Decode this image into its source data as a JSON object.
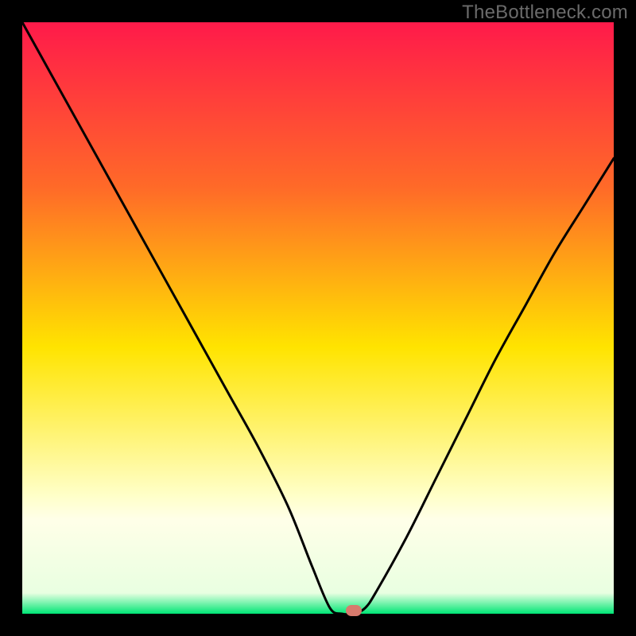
{
  "watermark": "TheBottleneck.com",
  "colors": {
    "frame": "#000000",
    "watermark": "#6b6b6b",
    "curve": "#000000",
    "marker": "#d77a6d",
    "grad_top": "#ff1a4a",
    "grad_mid_upper": "#ff8a20",
    "grad_mid": "#ffe400",
    "grad_pale": "#ffffc8",
    "grad_green": "#00e676"
  },
  "chart_data": {
    "type": "line",
    "title": "",
    "xlabel": "",
    "ylabel": "",
    "xlim": [
      0,
      100
    ],
    "ylim": [
      0,
      100
    ],
    "series": [
      {
        "name": "bottleneck-curve",
        "x": [
          0,
          5,
          10,
          15,
          20,
          25,
          30,
          35,
          40,
          45,
          49,
          52,
          54,
          56,
          58,
          60,
          65,
          70,
          75,
          80,
          85,
          90,
          95,
          100
        ],
        "y": [
          100,
          91,
          82,
          73,
          64,
          55,
          46,
          37,
          28,
          18,
          8,
          1,
          0,
          0,
          1,
          4,
          13,
          23,
          33,
          43,
          52,
          61,
          69,
          77
        ]
      }
    ],
    "marker": {
      "x": 56,
      "y": 0.5
    },
    "gradient_stops": [
      {
        "offset": 0.0,
        "color": "#ff1a4a"
      },
      {
        "offset": 0.28,
        "color": "#ff6a28"
      },
      {
        "offset": 0.55,
        "color": "#ffe400"
      },
      {
        "offset": 0.8,
        "color": "#ffffc8"
      },
      {
        "offset": 0.84,
        "color": "#ffffe8"
      },
      {
        "offset": 0.965,
        "color": "#e9ffe1"
      },
      {
        "offset": 1.0,
        "color": "#00e676"
      }
    ]
  }
}
